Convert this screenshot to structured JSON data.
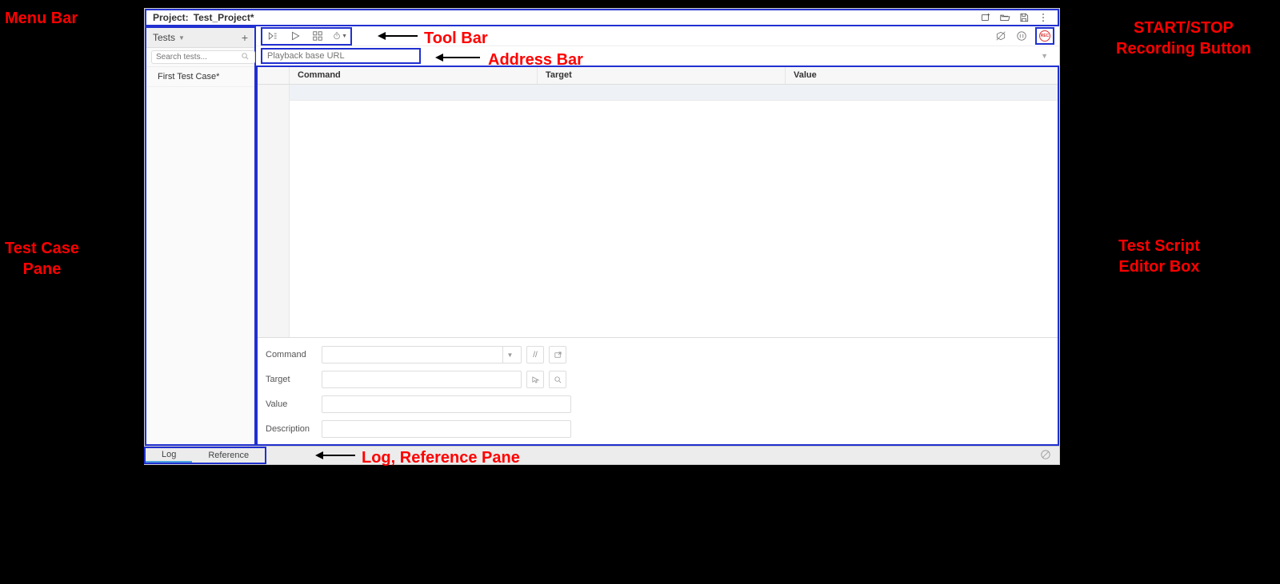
{
  "annotations": {
    "menuBar": "Menu Bar",
    "toolBar": "Tool Bar",
    "addressBar": "Address Bar",
    "testCasePane": "Test Case\nPane",
    "recordBtn": "START/STOP\nRecording Button",
    "scriptEditor": "Test Script\nEditor Box",
    "logRef": "Log, Reference Pane"
  },
  "menubar": {
    "projectLabel": "Project:",
    "projectName": "Test_Project*"
  },
  "sidebar": {
    "tabLabel": "Tests",
    "searchPlaceholder": "Search tests...",
    "items": [
      "First Test Case*"
    ]
  },
  "toolbar": {
    "recLabel": "REC"
  },
  "address": {
    "placeholder": "Playback base URL"
  },
  "grid": {
    "cols": {
      "command": "Command",
      "target": "Target",
      "value": "Value"
    }
  },
  "form": {
    "command": "Command",
    "target": "Target",
    "value": "Value",
    "description": "Description"
  },
  "bottom": {
    "log": "Log",
    "reference": "Reference"
  }
}
